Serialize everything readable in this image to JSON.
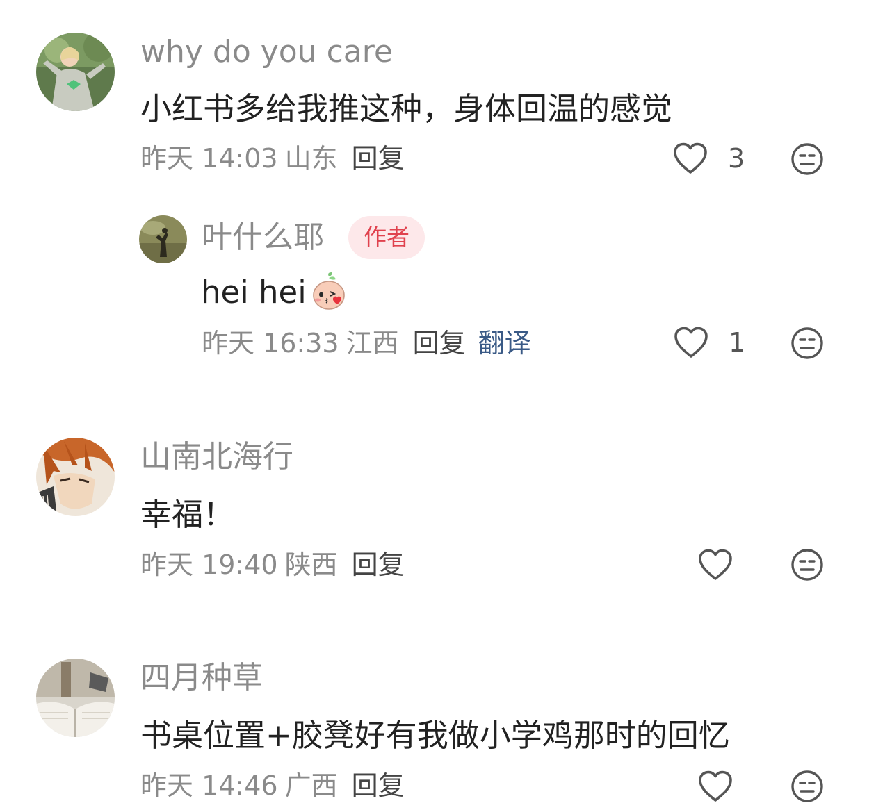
{
  "comments": [
    {
      "username": "why do you care",
      "text": "小红书多给我推这种，身体回温的感觉",
      "time": "昨天 14:03",
      "location": "山东",
      "reply_label": "回复",
      "like_count": "3",
      "reply": {
        "username": "叶什么耶",
        "author_badge": "作者",
        "text": "hei hei",
        "time": "昨天 16:33",
        "location": "江西",
        "reply_label": "回复",
        "translate_label": "翻译",
        "like_count": "1"
      }
    },
    {
      "username": "山南北海行",
      "text": "幸福！",
      "time": "昨天 19:40",
      "location": "陕西",
      "reply_label": "回复"
    },
    {
      "username": "四月种草",
      "text": "书桌位置+胶凳好有我做小学鸡那时的回忆",
      "time": "昨天 14:46",
      "location": "广西",
      "reply_label": "回复"
    }
  ],
  "icons": {
    "like": "heart-outline-icon",
    "dislike": "meh-face-icon",
    "emoji": "kiss-emoji-icon"
  },
  "colors": {
    "badge_text": "#e0424e",
    "badge_bg": "#fde8ea",
    "translate": "#3a5a86",
    "meta": "#8a8a8a"
  }
}
